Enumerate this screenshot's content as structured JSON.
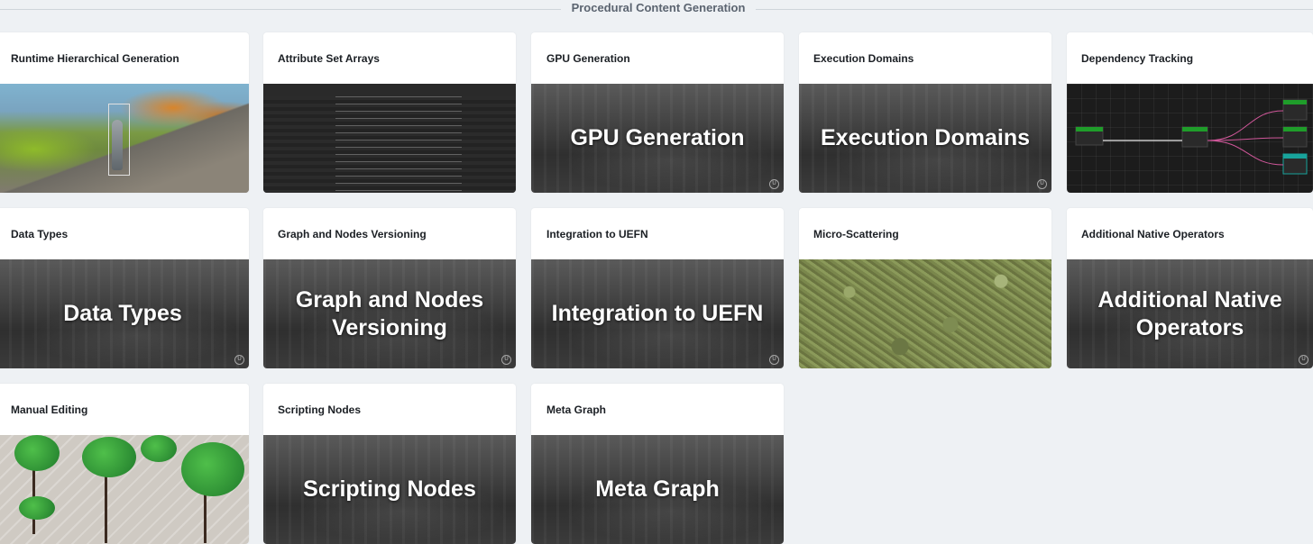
{
  "section": {
    "title": "Procedural Content Generation"
  },
  "cards": [
    {
      "title": "Runtime Hierarchical Generation",
      "thumb_type": "game-screenshot",
      "overlay": ""
    },
    {
      "title": "Attribute Set Arrays",
      "thumb_type": "table-screenshot",
      "overlay": ""
    },
    {
      "title": "GPU Generation",
      "thumb_type": "ue-placeholder",
      "overlay": "GPU Generation"
    },
    {
      "title": "Execution Domains",
      "thumb_type": "ue-placeholder",
      "overlay": "Execution Domains"
    },
    {
      "title": "Dependency Tracking",
      "thumb_type": "node-graph",
      "overlay": ""
    },
    {
      "title": "Data Types",
      "thumb_type": "ue-placeholder",
      "overlay": "Data Types"
    },
    {
      "title": "Graph and Nodes Versioning",
      "thumb_type": "ue-placeholder",
      "overlay": "Graph and Nodes Versioning"
    },
    {
      "title": "Integration to UEFN",
      "thumb_type": "ue-placeholder",
      "overlay": "Integration to UEFN"
    },
    {
      "title": "Micro-Scattering",
      "thumb_type": "moss-photo",
      "overlay": ""
    },
    {
      "title": "Additional Native Operators",
      "thumb_type": "ue-placeholder",
      "overlay": "Additional Native Operators"
    },
    {
      "title": "Manual Editing",
      "thumb_type": "trees-screenshot",
      "overlay": ""
    },
    {
      "title": "Scripting Nodes",
      "thumb_type": "ue-placeholder",
      "overlay": "Scripting Nodes"
    },
    {
      "title": "Meta Graph",
      "thumb_type": "ue-placeholder",
      "overlay": "Meta Graph"
    }
  ],
  "icons": {
    "ue_mark": "unreal-engine-logo-icon"
  },
  "colors": {
    "page_bg": "#eef1f4",
    "card_bg": "#ffffff",
    "header_text": "#5b6470",
    "card_title": "#1b1f24",
    "node_green": "#1f9d2a",
    "node_teal": "#18a39b",
    "wire_pink": "#d0579a"
  }
}
